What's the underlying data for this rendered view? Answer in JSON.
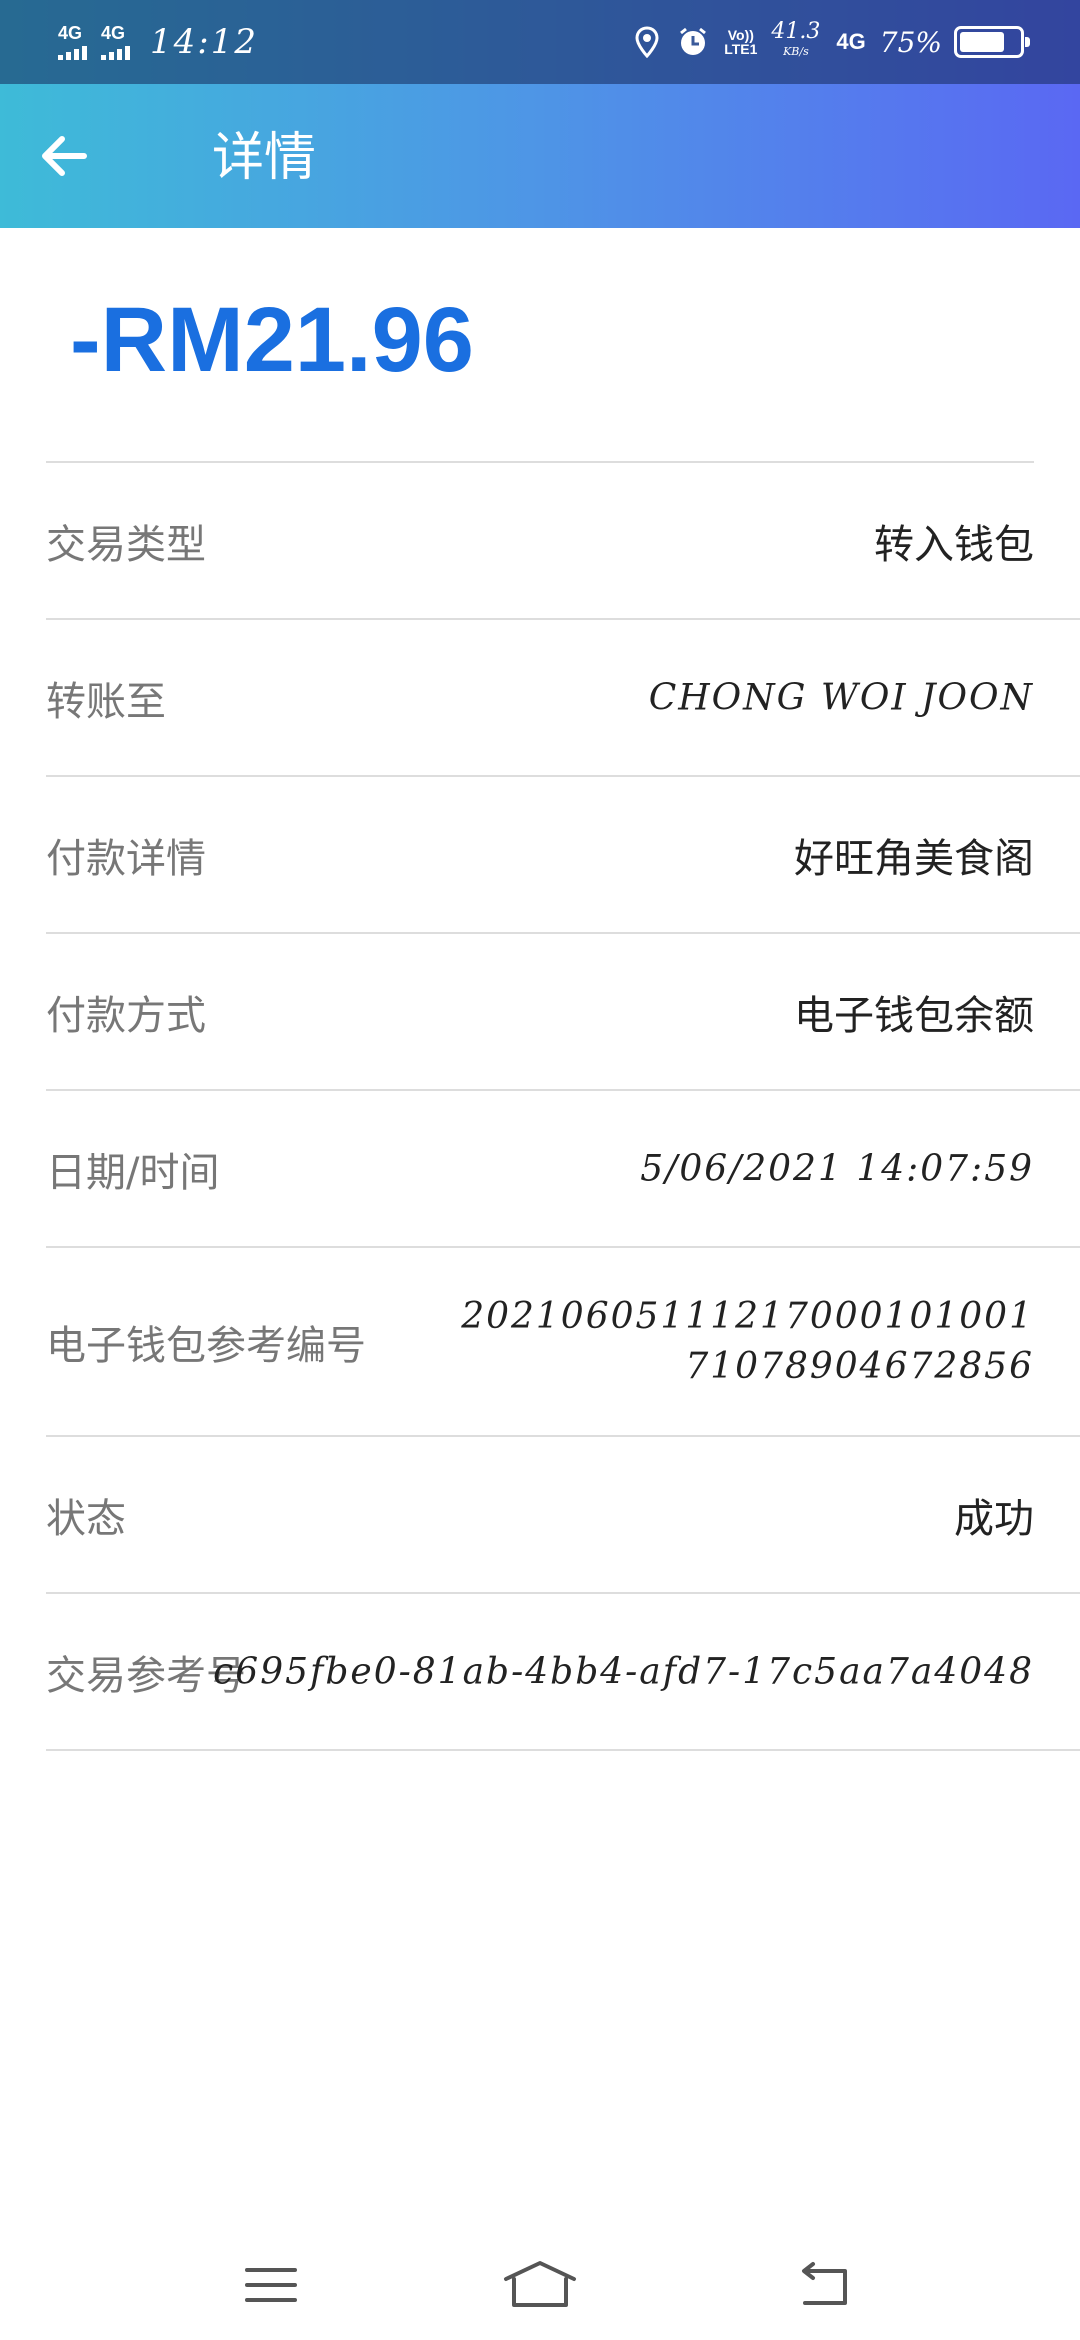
{
  "status_bar": {
    "signal1": "4G",
    "signal2": "4G",
    "time": "14:12",
    "volte": "Vo\nLTE1",
    "speed_value": "41.3",
    "speed_unit": "KB/s",
    "network": "4G",
    "battery_pct": "75%",
    "battery_level": 0.75
  },
  "header": {
    "title": "详情",
    "back_icon": "arrow-left-icon"
  },
  "amount": "-RM21.96",
  "colors": {
    "accent": "#1a6fe0",
    "header_start": "#3ebbd8",
    "header_end": "#5a68f3"
  },
  "details": [
    {
      "label": "交易类型",
      "value": "转入钱包"
    },
    {
      "label": "转账至",
      "value": "CHONG WOI JOON"
    },
    {
      "label": "付款详情",
      "value": "好旺角美食阁"
    },
    {
      "label": "付款方式",
      "value": "电子钱包余额"
    },
    {
      "label": "日期/时间",
      "value": "5/06/2021 14:07:59"
    },
    {
      "label": "电子钱包参考编号",
      "value": "20210605111217000101001 71078904672856"
    },
    {
      "label": "状态",
      "value": "成功"
    },
    {
      "label": "交易参考号",
      "value": "c695fbe0-81ab-4bb4-afd7-17c5aa7a4048"
    }
  ],
  "nav": {
    "menu_icon": "menu-icon",
    "home_icon": "home-icon",
    "back_icon": "back-icon"
  }
}
